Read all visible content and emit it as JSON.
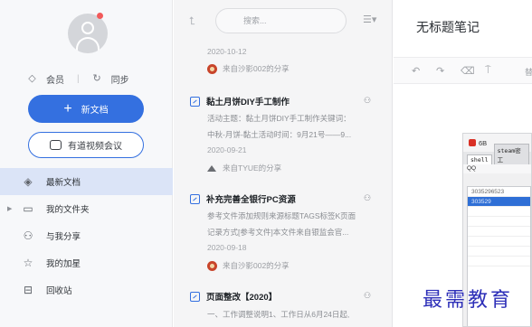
{
  "sidebar": {
    "member_label": "会员",
    "sync_label": "同步",
    "new_doc_label": "新文档",
    "meeting_label": "有道视频会议",
    "nav": [
      {
        "label": "最新文档",
        "icon": "layers-icon",
        "active": true
      },
      {
        "label": "我的文件夹",
        "icon": "folder-icon",
        "active": false
      },
      {
        "label": "与我分享",
        "icon": "share-users-icon",
        "active": false
      },
      {
        "label": "我的加星",
        "icon": "star-icon",
        "active": false
      },
      {
        "label": "回收站",
        "icon": "trash-icon",
        "active": false
      }
    ]
  },
  "list": {
    "search_placeholder": "搜索...",
    "notes": [
      {
        "title": "",
        "lines": [],
        "date": "2020-10-12",
        "source": "来自沙影002的分享"
      },
      {
        "title": "黏土月饼DIY手工制作",
        "lines": [
          "活动主题：黏土月饼DIY手工制作关键词：",
          "中秋-月饼-黏土活动时间：9月21号——9..."
        ],
        "date": "2020-09-21",
        "source": "来自TYUE的分享"
      },
      {
        "title": "补充完善全银行PC资源",
        "lines": [
          "参考文件添加规则来源标题TAGS标签K页面",
          "记录方式[参考文件]本文件来自银监会官..."
        ],
        "date": "2020-09-18",
        "source": "来自沙影002的分享"
      },
      {
        "title": "页面整改【2020】",
        "lines": [
          "一、工作调整说明1、工作日从6月24日起,"
        ],
        "date": "",
        "source": ""
      }
    ]
  },
  "editor": {
    "title": "无标题笔记",
    "toolbar_extra": "替"
  },
  "embedded_screenshot": {
    "window_title": "6B",
    "tabs": [
      "shell",
      "steam密工"
    ],
    "group_label": "QQ",
    "rows": [
      "3035296523",
      "303529",
      ""
    ]
  },
  "watermark": "最需教育",
  "colors": {
    "accent": "#3470e0",
    "active_nav_bg": "#dbe4f7",
    "notification_dot": "#f25a5a"
  }
}
